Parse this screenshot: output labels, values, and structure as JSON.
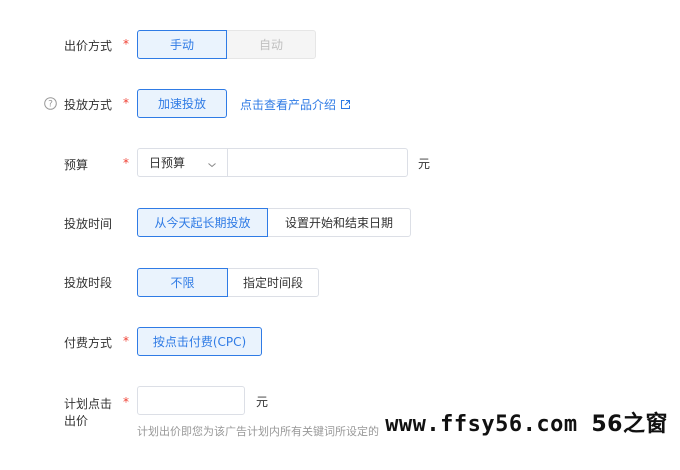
{
  "bid_method": {
    "label": "出价方式",
    "options": [
      "手动",
      "自动"
    ]
  },
  "delivery_method": {
    "label": "投放方式",
    "option": "加速投放",
    "link": "点击查看产品介绍",
    "help_icon": "question-circle-icon",
    "link_icon": "external-link-icon"
  },
  "budget": {
    "label": "预算",
    "select_value": "日预算",
    "input_value": "",
    "unit": "元"
  },
  "delivery_time": {
    "label": "投放时间",
    "options": [
      "从今天起长期投放",
      "设置开始和结束日期"
    ]
  },
  "delivery_period": {
    "label": "投放时段",
    "options": [
      "不限",
      "指定时间段"
    ]
  },
  "payment_method": {
    "label": "付费方式",
    "option": "按点击付费(CPC)"
  },
  "plan_bid": {
    "label_line1": "计划点击",
    "label_line2": "出价",
    "input_value": "",
    "unit": "元",
    "help_text": "计划出价即您为该广告计划内所有关键词所设定的"
  },
  "watermark": {
    "text": "www.ffsy56.com",
    "cn": "56之窗"
  },
  "colors": {
    "accent": "#2f7be5",
    "required": "#f04134",
    "active_bg": "#eaf3fd"
  }
}
